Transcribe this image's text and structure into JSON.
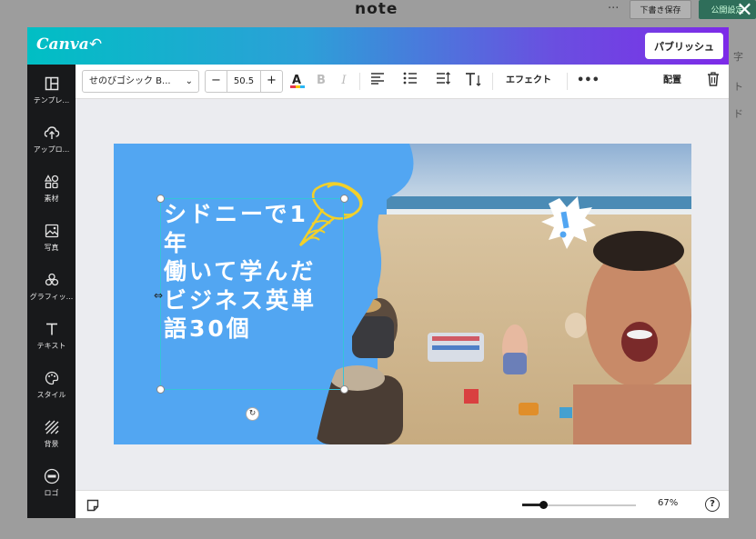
{
  "note": {
    "logo": "note",
    "menu_icon": "more-dots-icon",
    "draft_label": "下書き保存",
    "publish_label": "公開設定",
    "side_fragments": [
      "字",
      "ト",
      "ド"
    ]
  },
  "canva": {
    "logo": "Canva",
    "publish_label": "パブリッシュ",
    "sidebar": [
      {
        "icon": "template-icon",
        "label": "テンプレ..."
      },
      {
        "icon": "upload-icon",
        "label": "アップロ..."
      },
      {
        "icon": "elements-icon",
        "label": "素材"
      },
      {
        "icon": "photo-icon",
        "label": "写真"
      },
      {
        "icon": "graphics-icon",
        "label": "グラフィッ..."
      },
      {
        "icon": "text-icon",
        "label": "テキスト"
      },
      {
        "icon": "style-icon",
        "label": "スタイル"
      },
      {
        "icon": "background-icon",
        "label": "背景"
      },
      {
        "icon": "logo-icon",
        "label": "ロゴ"
      }
    ],
    "toolbar": {
      "font_name": "せのびゴシック B...",
      "font_size": "50.5",
      "minus": "−",
      "plus": "+",
      "effect_label": "エフェクト",
      "arrange_label": "配置",
      "text_color": "#e8384f"
    },
    "design": {
      "headline_lines": [
        "シドニーで1",
        "年",
        "働いて学んだ",
        "ビジネス英単",
        "語30個"
      ],
      "accent_blue": "#52a6f2"
    },
    "zoom": "67%",
    "zoom_fraction": 0.19,
    "help_label": "?"
  }
}
